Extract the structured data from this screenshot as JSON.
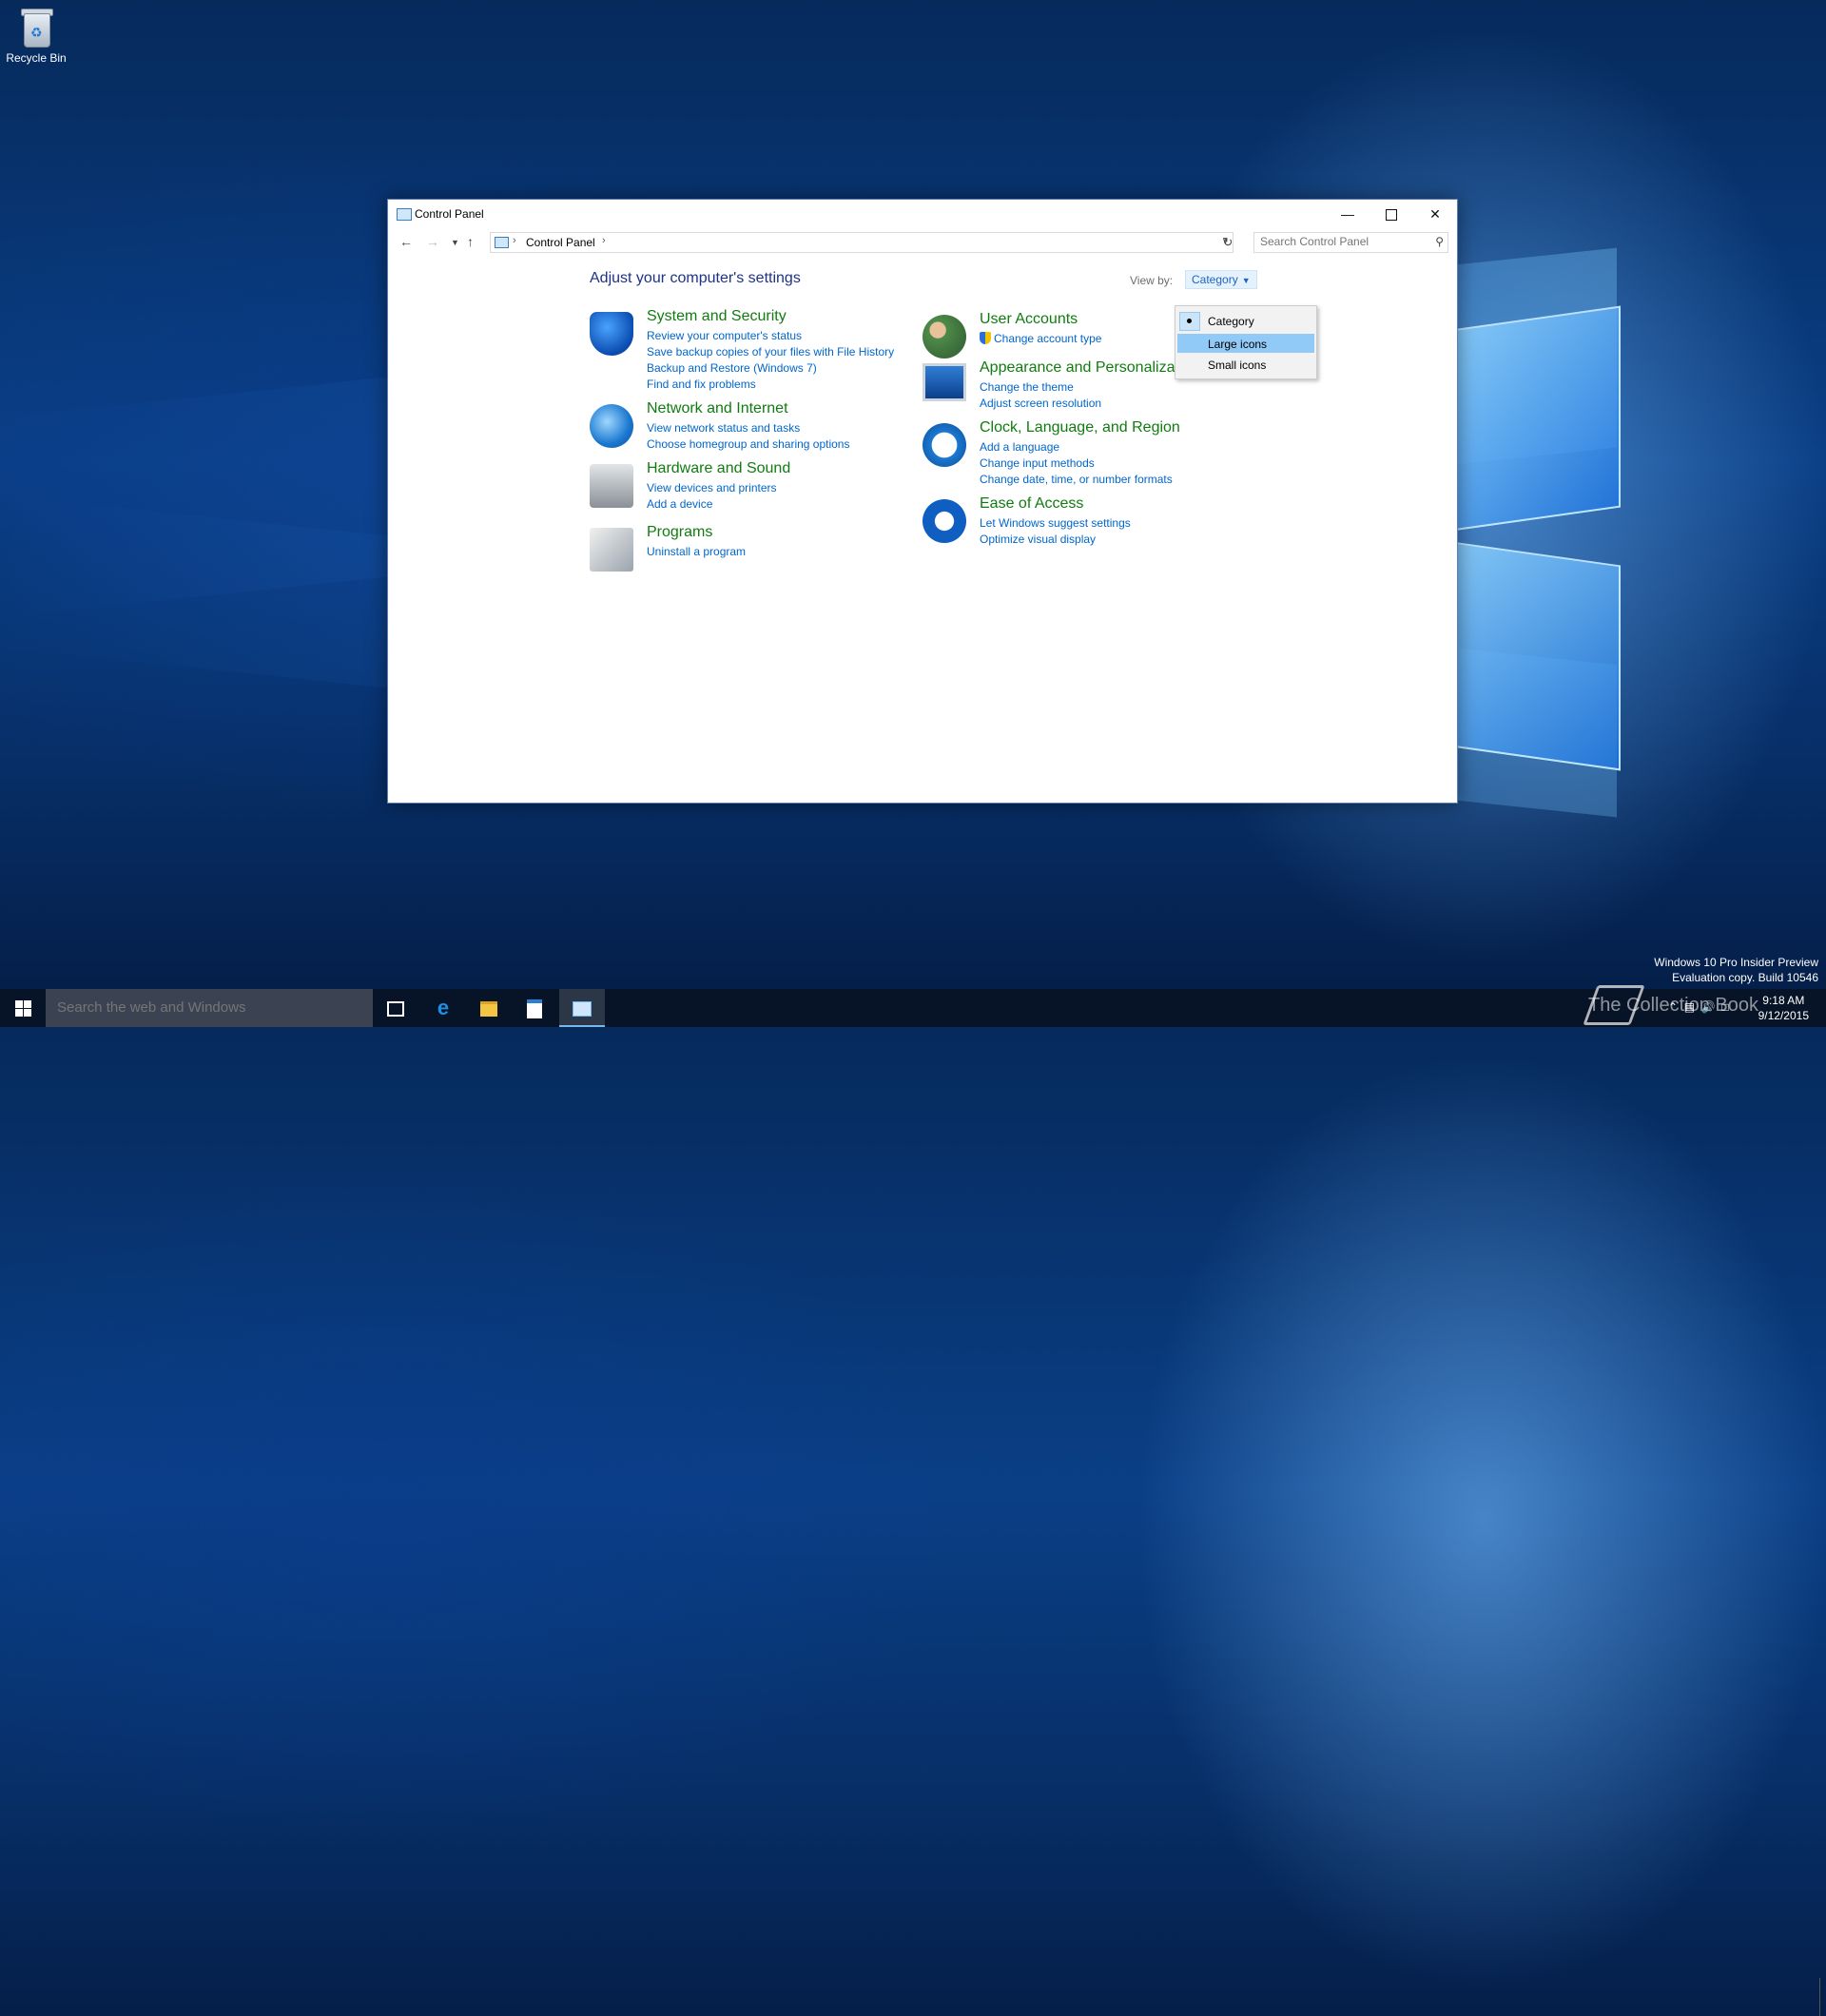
{
  "desktop": {
    "recycle_bin_label": "Recycle Bin"
  },
  "window": {
    "title": "Control Panel",
    "nav": {
      "breadcrumb": "Control Panel",
      "search_placeholder": "Search Control Panel"
    },
    "heading": "Adjust your computer's settings",
    "view_by_label": "View by:",
    "view_by_value": "Category",
    "view_menu": {
      "items": [
        "Category",
        "Large icons",
        "Small icons"
      ],
      "selected": "Category",
      "highlighted": "Large icons"
    },
    "left_categories": [
      {
        "title": "System and Security",
        "links": [
          "Review your computer's status",
          "Save backup copies of your files with File History",
          "Backup and Restore (Windows 7)",
          "Find and fix problems"
        ]
      },
      {
        "title": "Network and Internet",
        "links": [
          "View network status and tasks",
          "Choose homegroup and sharing options"
        ]
      },
      {
        "title": "Hardware and Sound",
        "links": [
          "View devices and printers",
          "Add a device"
        ]
      },
      {
        "title": "Programs",
        "links": [
          "Uninstall a program"
        ]
      }
    ],
    "right_categories": [
      {
        "title": "User Accounts",
        "links": [
          "Change account type"
        ]
      },
      {
        "title": "Appearance and Personalization",
        "links": [
          "Change the theme",
          "Adjust screen resolution"
        ]
      },
      {
        "title": "Clock, Language, and Region",
        "links": [
          "Add a language",
          "Change input methods",
          "Change date, time, or number formats"
        ]
      },
      {
        "title": "Ease of Access",
        "links": [
          "Let Windows suggest settings",
          "Optimize visual display"
        ]
      }
    ]
  },
  "taskbar": {
    "search_placeholder": "Search the web and Windows",
    "watermark_line1": "Windows 10 Pro Insider Preview",
    "watermark_line2": "Evaluation copy. Build 10546",
    "brand": "The Collection Book",
    "time": "9:18 AM",
    "date": "9/12/2015"
  },
  "colors": {
    "category_title": "#107c10",
    "link": "#0066cc",
    "heading": "#1e3287",
    "menu_highlight": "#91c9f7"
  }
}
